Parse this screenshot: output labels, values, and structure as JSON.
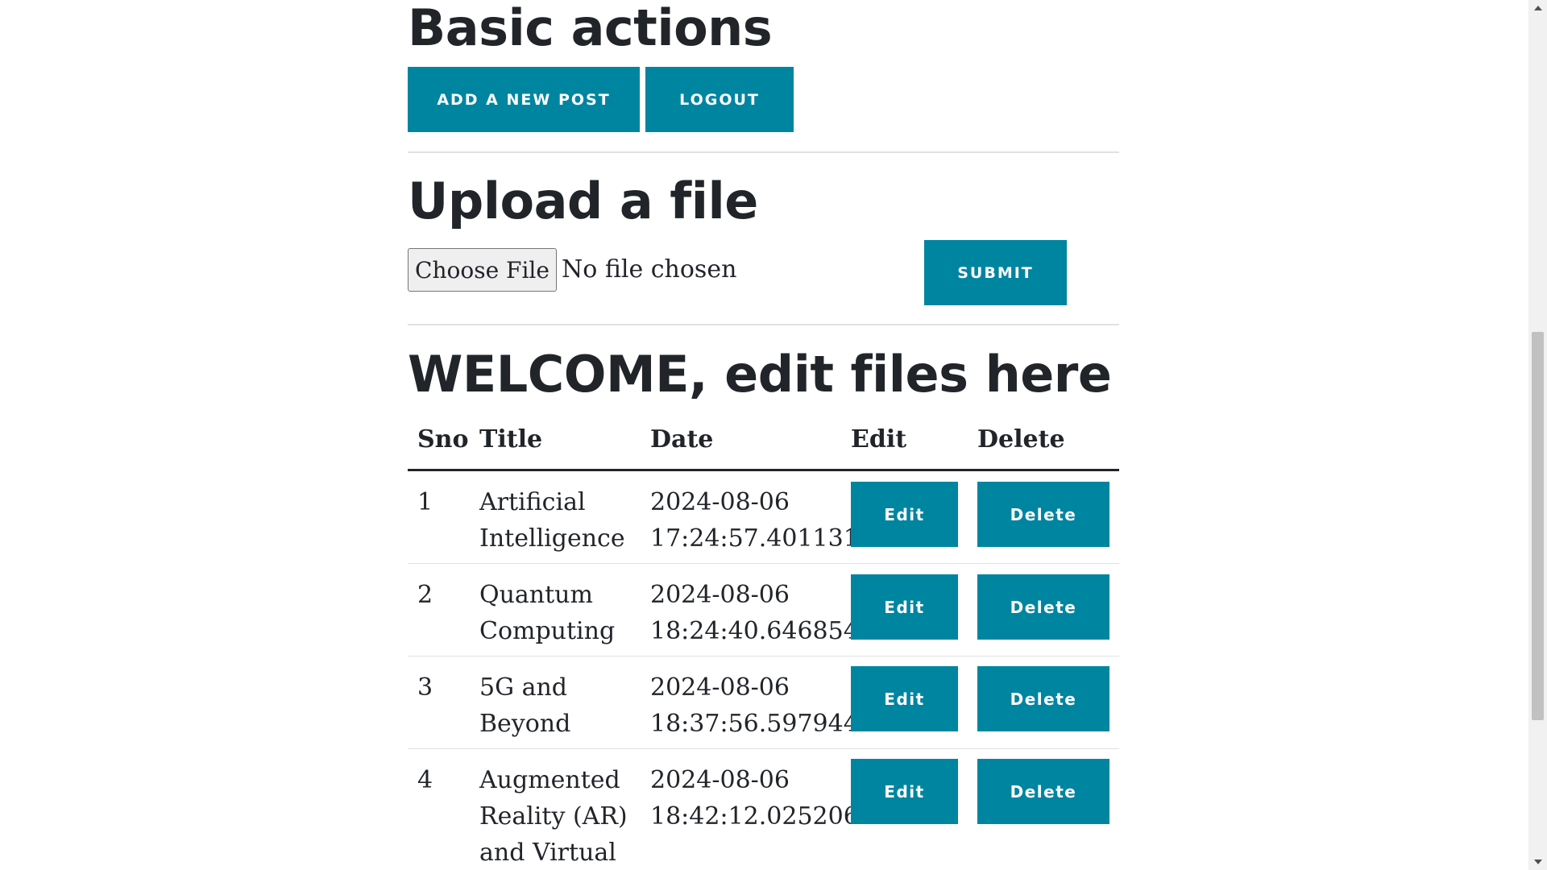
{
  "basic_actions": {
    "heading": "Basic actions",
    "add_post_label": "ADD A NEW POST",
    "logout_label": "LOGOUT"
  },
  "upload": {
    "heading": "Upload a file",
    "choose_file_label": "Choose File",
    "file_status": "No file chosen",
    "submit_label": "SUBMIT"
  },
  "welcome": {
    "heading": "WELCOME, edit files here"
  },
  "table": {
    "headers": [
      "Sno",
      "Title",
      "Date",
      "Edit",
      "Delete"
    ],
    "rows": [
      {
        "sno": "1",
        "title": "Artificial Intelligence",
        "date": "2024-08-06 17:24:57.401131",
        "edit_label": "Edit",
        "delete_label": "Delete"
      },
      {
        "sno": "2",
        "title": "Quantum Computing",
        "date": "2024-08-06 18:24:40.646854",
        "edit_label": "Edit",
        "delete_label": "Delete"
      },
      {
        "sno": "3",
        "title": "5G and Beyond",
        "date": "2024-08-06 18:37:56.597944",
        "edit_label": "Edit",
        "delete_label": "Delete"
      },
      {
        "sno": "4",
        "title": "Augmented Reality (AR) and Virtual",
        "date": "2024-08-06 18:42:12.025206",
        "edit_label": "Edit",
        "delete_label": "Delete"
      }
    ]
  },
  "colors": {
    "accent": "#0085a1",
    "text": "#212529",
    "divider": "#dee2e6"
  },
  "icons": {
    "scroll_up": "chevron-up-icon",
    "scroll_down": "chevron-down-icon"
  }
}
